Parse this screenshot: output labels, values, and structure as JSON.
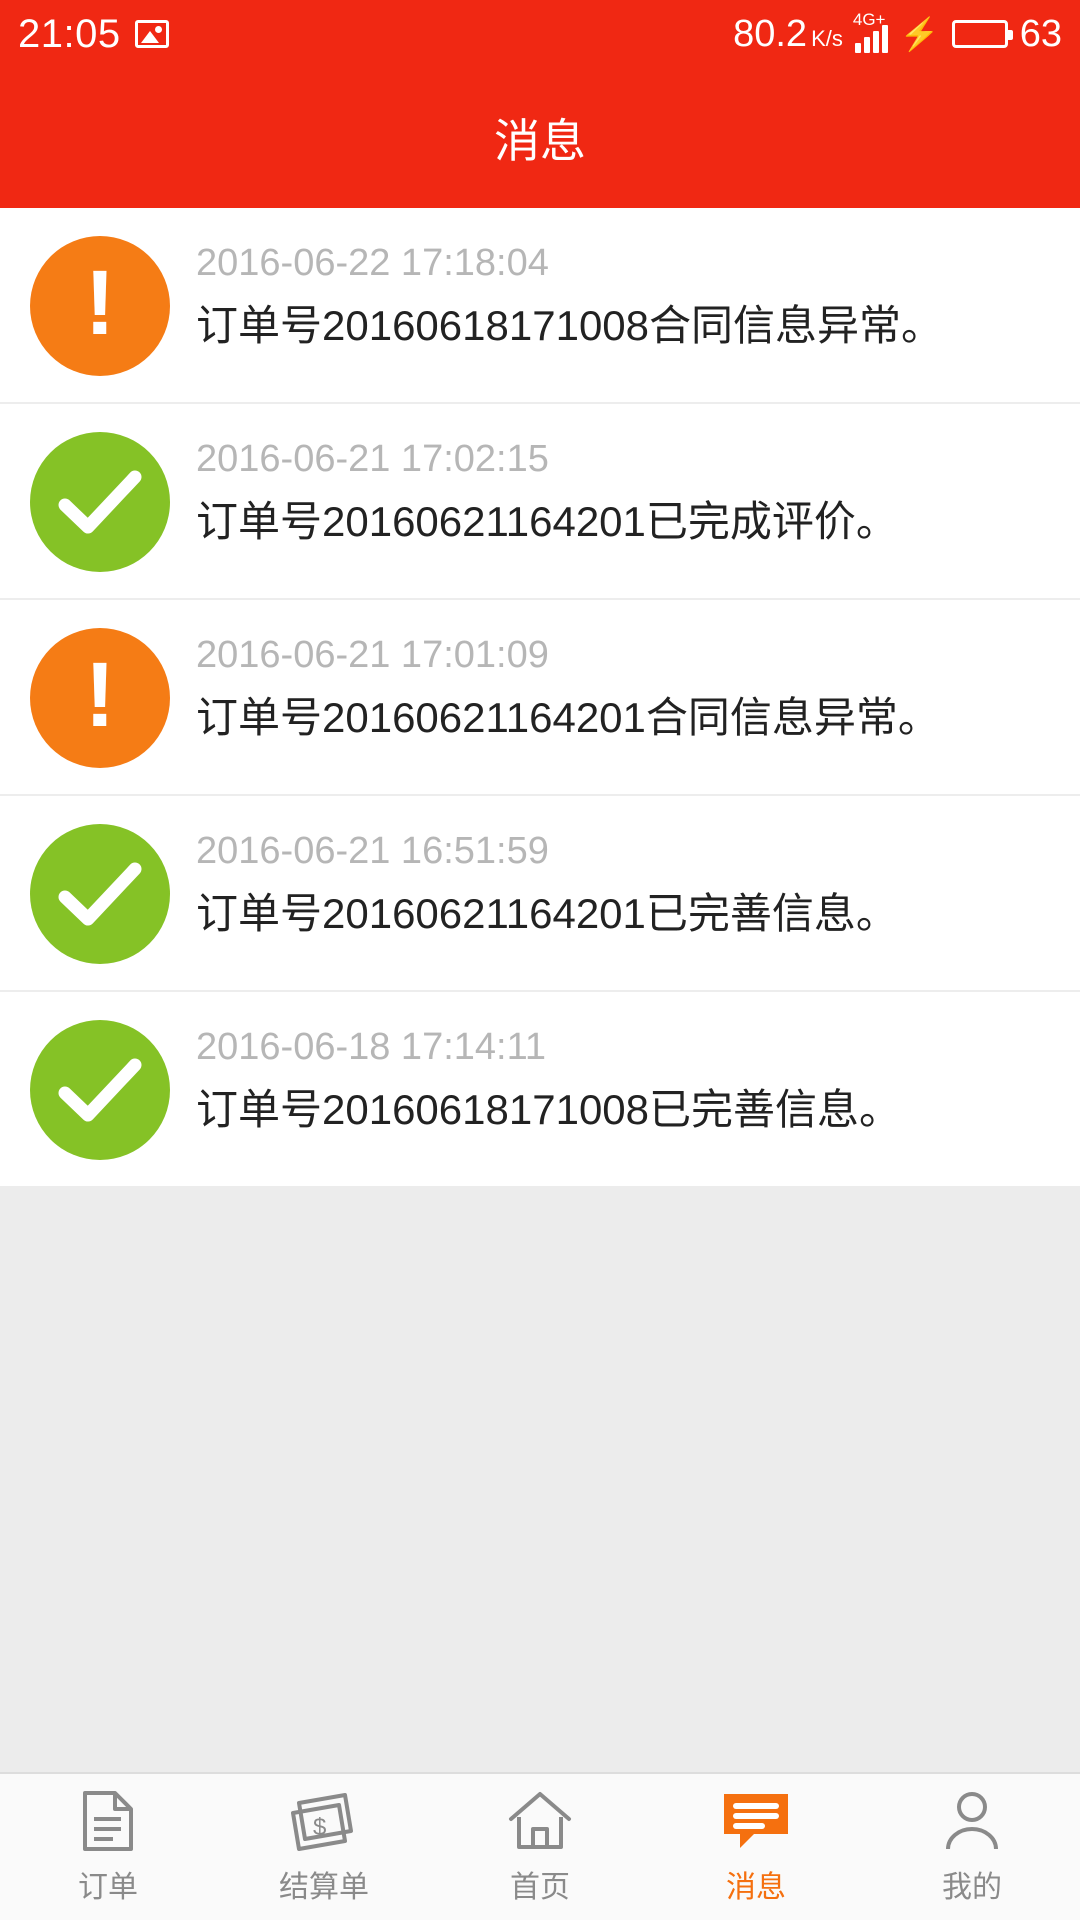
{
  "status_bar": {
    "time": "21:05",
    "photo_icon": "image-icon",
    "speed_value": "80.2",
    "speed_unit": "K/s",
    "network": "4G+",
    "charging_icon": "bolt-icon",
    "battery_percent": "63",
    "battery_fill_color": "#5bd31c",
    "background_color": "#f02813"
  },
  "title_bar": {
    "title": "消息",
    "background_color": "#f02813"
  },
  "messages": [
    {
      "icon": "alert-icon",
      "type": "alert",
      "color": "#f57c15",
      "time": "2016-06-22 17:18:04",
      "text": "订单号20160618171008合同信息异常。"
    },
    {
      "icon": "check-icon",
      "type": "done",
      "color": "#85c226",
      "time": "2016-06-21 17:02:15",
      "text": "订单号20160621164201已完成评价。"
    },
    {
      "icon": "alert-icon",
      "type": "alert",
      "color": "#f57c15",
      "time": "2016-06-21 17:01:09",
      "text": "订单号20160621164201合同信息异常。"
    },
    {
      "icon": "check-icon",
      "type": "done",
      "color": "#85c226",
      "time": "2016-06-21 16:51:59",
      "text": "订单号20160621164201已完善信息。"
    },
    {
      "icon": "check-icon",
      "type": "done",
      "color": "#85c226",
      "time": "2016-06-18 17:14:11",
      "text": "订单号20160618171008已完善信息。"
    }
  ],
  "tab_bar": {
    "active_color": "#f5700f",
    "inactive_color": "#8a8a8a",
    "items": [
      {
        "icon": "document-icon",
        "label": "订单",
        "active": false
      },
      {
        "icon": "money-icon",
        "label": "结算单",
        "active": false
      },
      {
        "icon": "home-icon",
        "label": "首页",
        "active": false
      },
      {
        "icon": "message-icon",
        "label": "消息",
        "active": true
      },
      {
        "icon": "person-icon",
        "label": "我的",
        "active": false
      }
    ]
  }
}
